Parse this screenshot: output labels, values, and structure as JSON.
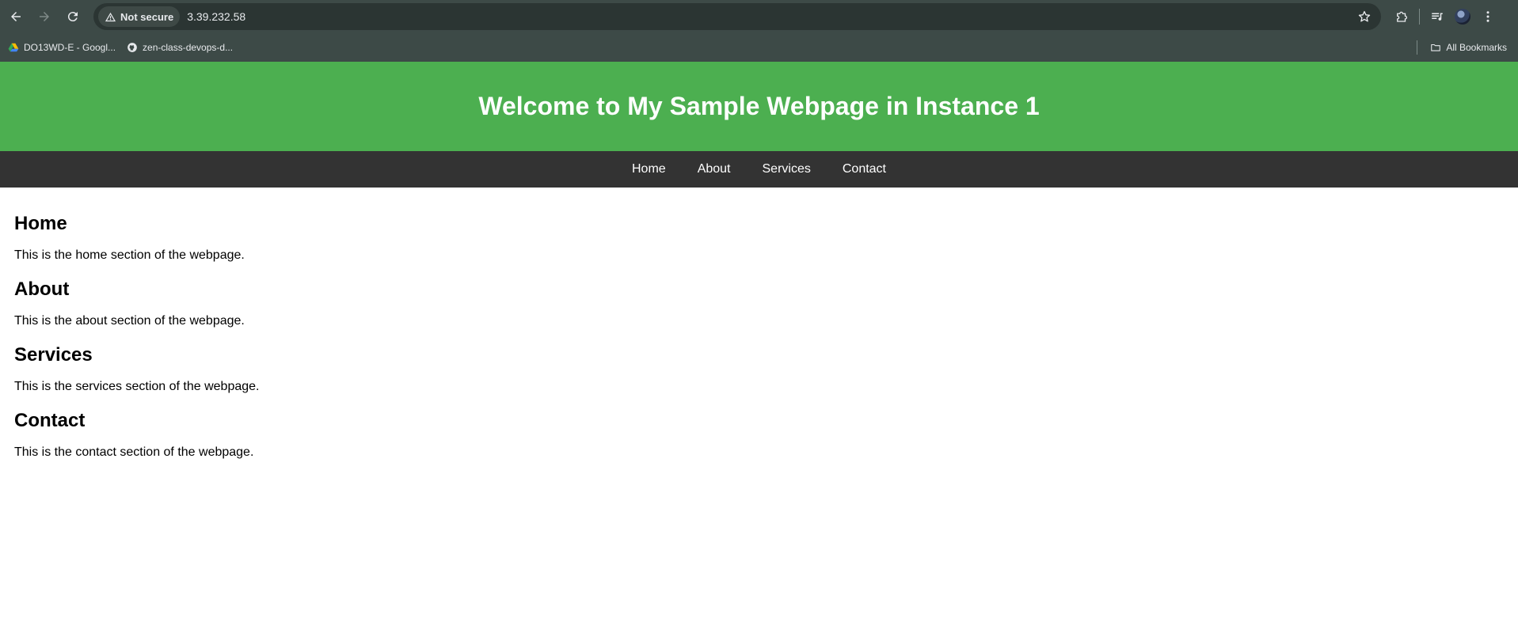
{
  "browser": {
    "security_label": "Not secure",
    "url": "3.39.232.58",
    "bookmarks": [
      {
        "label": "DO13WD-E - Googl..."
      },
      {
        "label": "zen-class-devops-d..."
      }
    ],
    "all_bookmarks_label": "All Bookmarks"
  },
  "page": {
    "header_title": "Welcome to My Sample Webpage in Instance 1",
    "nav": [
      "Home",
      "About",
      "Services",
      "Contact"
    ],
    "sections": [
      {
        "title": "Home",
        "text": "This is the home section of the webpage."
      },
      {
        "title": "About",
        "text": "This is the about section of the webpage."
      },
      {
        "title": "Services",
        "text": "This is the services section of the webpage."
      },
      {
        "title": "Contact",
        "text": "This is the contact section of the webpage."
      }
    ]
  },
  "colors": {
    "header_bg": "#4caf50",
    "nav_bg": "#333333",
    "chrome_bg": "#3d4a47"
  }
}
